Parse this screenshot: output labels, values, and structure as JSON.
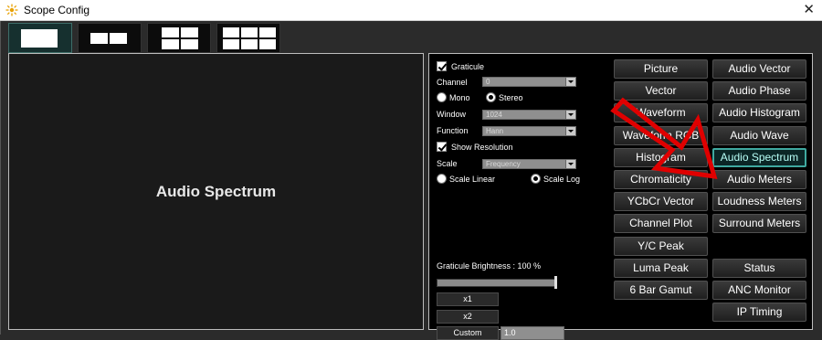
{
  "window": {
    "title": "Scope Config",
    "close_glyph": "✕",
    "app_icon": "scope-config-app-icon"
  },
  "layouts": [
    {
      "name": "single",
      "selected": true
    },
    {
      "name": "two-column"
    },
    {
      "name": "four-grid"
    },
    {
      "name": "six-grid"
    }
  ],
  "preview": {
    "label": "Audio Spectrum"
  },
  "settings": {
    "graticule_label": "Graticule",
    "graticule_checked": true,
    "channel_label": "Channel",
    "channel_value": "0",
    "mono_label": "Mono",
    "stereo_label": "Stereo",
    "stereo_selected": true,
    "window_label": "Window",
    "window_value": "1024",
    "function_label": "Function",
    "function_value": "Hann",
    "show_resolution_label": "Show Resolution",
    "show_resolution_checked": true,
    "scale_label": "Scale",
    "scale_value": "Frequency",
    "scale_linear_label": "Scale Linear",
    "scale_log_label": "Scale Log",
    "scale_log_selected": true,
    "graticule_brightness_label": "Graticule Brightness : 100 %",
    "graticule_brightness_percent": 100,
    "x1_label": "x1",
    "x2_label": "x2",
    "custom_label": "Custom",
    "custom_value": "1.0"
  },
  "scope_buttons": {
    "col1": [
      "Picture",
      "Vector",
      "Waveform",
      "Waveform RGB",
      "Histogram",
      "Chromaticity",
      "YCbCr Vector",
      "Channel Plot",
      "Y/C Peak",
      "Luma Peak",
      "6 Bar Gamut"
    ],
    "col2": [
      "Audio Vector",
      "Audio Phase",
      "Audio Histogram",
      "Audio Wave",
      "Audio Spectrum",
      "Audio Meters",
      "Loudness Meters",
      "Surround Meters",
      "Status",
      "ANC Monitor",
      "IP Timing"
    ],
    "active": "Audio Spectrum"
  },
  "annotation": {
    "arrow_color": "#e00000"
  },
  "colors": {
    "accent": "#3fa9a0",
    "panel_bg": "#000000",
    "client_bg": "#2b2b2b"
  }
}
